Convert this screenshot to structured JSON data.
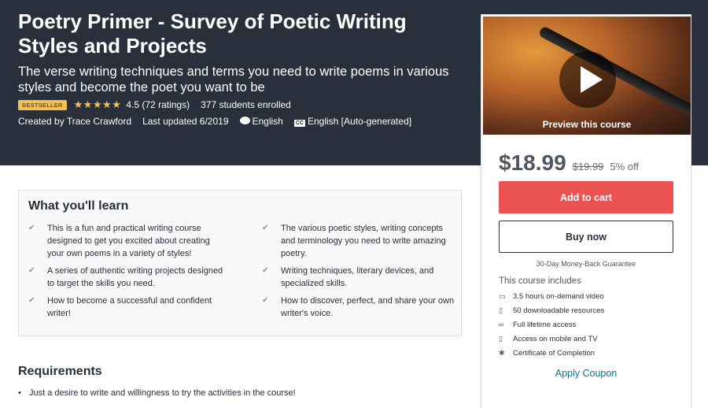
{
  "course": {
    "title": "Poetry Primer - Survey of Poetic Writing Styles and Projects",
    "subtitle": "The verse writing techniques and terms you need to write poems in various styles and become the poet you want to be",
    "badge": "BESTSELLER",
    "stars": "★★★★★",
    "rating_text": "4.5 (72 ratings)",
    "enrolled": "377 students enrolled",
    "created_by": "Created by Trace Crawford",
    "last_updated": "Last updated 6/2019",
    "language": "English",
    "captions": "English [Auto-generated]",
    "captions_icon_text": "CC"
  },
  "sidebar": {
    "preview_label": "Preview this course",
    "price": "$18.99",
    "original_price": "$19.99",
    "discount": "5% off",
    "add_to_cart": "Add to cart",
    "buy_now": "Buy now",
    "guarantee": "30-Day Money-Back Guarantee",
    "includes_title": "This course includes",
    "includes": [
      {
        "icon": "video-icon",
        "text": "3.5 hours on-demand video"
      },
      {
        "icon": "file-icon",
        "text": "50 downloadable resources"
      },
      {
        "icon": "infinity-icon",
        "text": "Full lifetime access"
      },
      {
        "icon": "mobile-icon",
        "text": "Access on mobile and TV"
      },
      {
        "icon": "certificate-icon",
        "text": "Certificate of Completion"
      }
    ],
    "coupon": "Apply Coupon"
  },
  "learn": {
    "title": "What you'll learn",
    "left": [
      "This is a fun and practical writing course designed to get you excited about creating your own poems in a variety of styles!",
      "A series of authentic writing projects designed to target the skills you need.",
      "How to become a successful and confident writer!"
    ],
    "right": [
      "The various poetic styles, writing concepts and terminology you need to write amazing poetry.",
      "Writing techniques, literary devices, and specialized skills.",
      "How to discover, perfect, and share your own writer's voice."
    ]
  },
  "requirements": {
    "title": "Requirements",
    "items": [
      "Just a desire to write and willingness to try the activities in the course!"
    ]
  },
  "colors": {
    "hero_bg": "#29303b",
    "accent_red": "#ec5252",
    "star": "#f4c150",
    "link": "#007791"
  }
}
